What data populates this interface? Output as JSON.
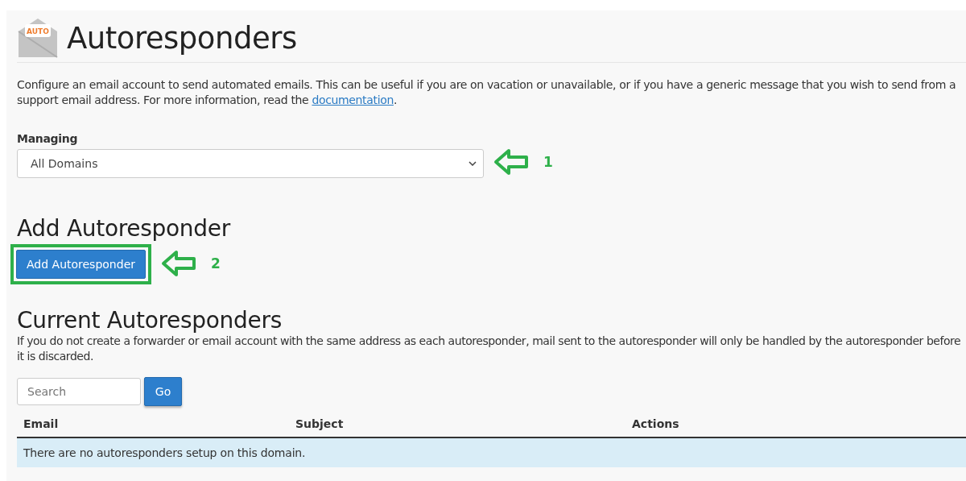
{
  "page": {
    "icon_label": "AUTO",
    "title": "Autoresponders",
    "intro": "Configure an email account to send automated emails. This can be useful if you are on vacation or unavailable, or if you have a generic message that you wish to send from a support email address. For more information, read the ",
    "intro_link": "documentation",
    "intro_end": "."
  },
  "managing": {
    "label": "Managing",
    "value": "All Domains",
    "annotation": "1"
  },
  "add_section": {
    "heading": "Add Autoresponder",
    "button": "Add Autoresponder",
    "annotation": "2"
  },
  "current_section": {
    "heading": "Current Autoresponders",
    "note": "If you do not create a forwarder or email account with the same address as each autoresponder, mail sent to the autoresponder will only be handled by the autoresponder before it is discarded.",
    "search": {
      "placeholder": "Search",
      "button": "Go"
    },
    "table": {
      "columns": [
        "Email",
        "Subject",
        "Actions"
      ],
      "empty_message": "There are no autoresponders setup on this domain."
    }
  }
}
